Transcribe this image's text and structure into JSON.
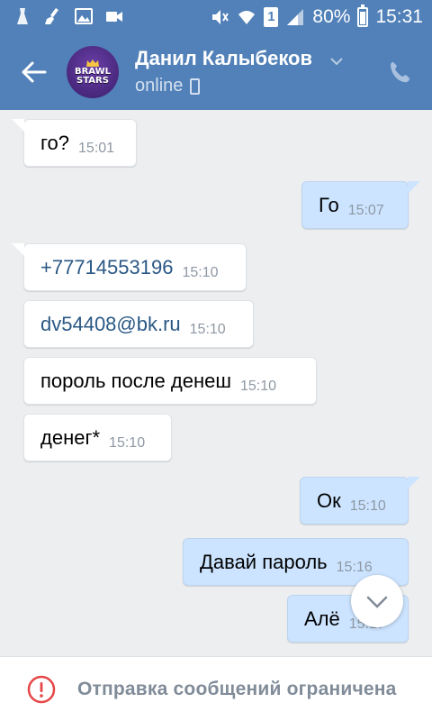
{
  "status_bar": {
    "battery": "80%",
    "clock": "15:31",
    "sim": "1",
    "icons": [
      "cleaner-icon",
      "broom-icon",
      "image-icon",
      "video-icon",
      "mute-icon",
      "wifi-icon",
      "sim-icon",
      "signal-icon",
      "battery-icon"
    ]
  },
  "header": {
    "contact_name": "Данил Калыбеков",
    "presence": "online",
    "avatar_line1": "BRAWL",
    "avatar_line2": "STARS"
  },
  "messages": [
    {
      "direction": "in",
      "text": "го?",
      "time": "15:01"
    },
    {
      "direction": "out",
      "text": "Го",
      "time": "15:07"
    },
    {
      "direction": "in",
      "text": "+77714553196",
      "time": "15:10",
      "link": true
    },
    {
      "direction": "in",
      "text": "dv54408@bk.ru",
      "time": "15:10",
      "link": true
    },
    {
      "direction": "in",
      "text": "пороль после денеш",
      "time": "15:10"
    },
    {
      "direction": "in",
      "text": "денег*",
      "time": "15:10"
    },
    {
      "direction": "out",
      "text": "Ок",
      "time": "15:10"
    },
    {
      "direction": "out",
      "text": "Давай пароль",
      "time": "15:16"
    },
    {
      "direction": "out",
      "text": "Алё",
      "time": "15:17"
    }
  ],
  "footer": {
    "restriction_text": "Отправка сообщений ограничена"
  },
  "colors": {
    "header_bg": "#5181b8",
    "chat_bg": "#edeef0",
    "outgoing_bubble": "#cce4ff",
    "incoming_bubble": "#ffffff",
    "link": "#2a5885",
    "warning": "#e64646"
  }
}
